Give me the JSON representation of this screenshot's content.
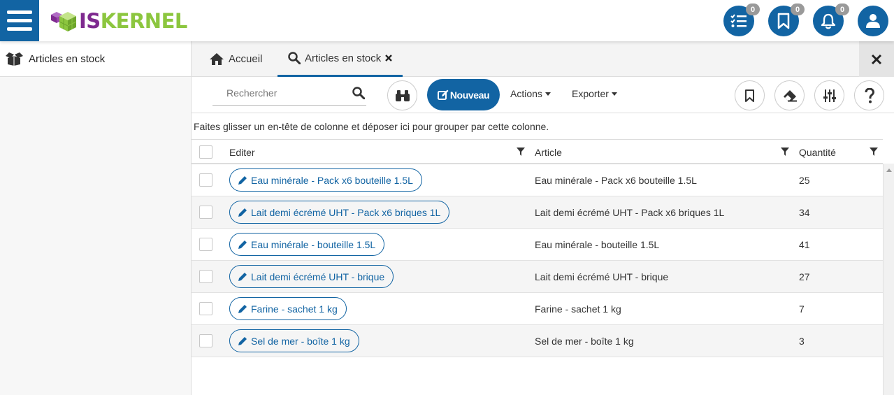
{
  "app": {
    "logo_part1": "IS",
    "logo_part2": "KERNEL",
    "badges": {
      "tasks": "0",
      "bookmarks": "0",
      "notifications": "0"
    },
    "brand_color": "#1264a3"
  },
  "sidebar": {
    "items": [
      {
        "label": "Articles en stock",
        "icon": "box-open-icon"
      }
    ]
  },
  "tabs": [
    {
      "label": "Accueil",
      "icon": "home-icon"
    },
    {
      "label": "Articles en stock",
      "icon": "search-icon",
      "active": true
    }
  ],
  "toolbar": {
    "search_placeholder": "Rechercher",
    "nouveau_label": "Nouveau",
    "actions_label": "Actions",
    "exporter_label": "Exporter"
  },
  "grid": {
    "group_hint": "Faites glisser un en-tête de colonne et déposer ici pour grouper par cette colonne.",
    "columns": {
      "editer": "Editer",
      "article": "Article",
      "quantite": "Quantité"
    },
    "rows": [
      {
        "edit": "Eau minérale - Pack x6 bouteille 1.5L",
        "article": "Eau minérale - Pack x6 bouteille 1.5L",
        "qty": "25"
      },
      {
        "edit": "Lait demi écrémé UHT - Pack x6 briques 1L",
        "article": "Lait demi écrémé UHT - Pack x6 briques 1L",
        "qty": "34"
      },
      {
        "edit": "Eau minérale - bouteille 1.5L",
        "article": "Eau minérale - bouteille 1.5L",
        "qty": "41"
      },
      {
        "edit": "Lait demi écrémé UHT - brique",
        "article": "Lait demi écrémé UHT - brique",
        "qty": "27"
      },
      {
        "edit": "Farine - sachet 1 kg",
        "article": "Farine - sachet 1 kg",
        "qty": "7"
      },
      {
        "edit": "Sel de mer - boîte 1 kg",
        "article": "Sel de mer - boîte 1 kg",
        "qty": "3"
      }
    ]
  }
}
